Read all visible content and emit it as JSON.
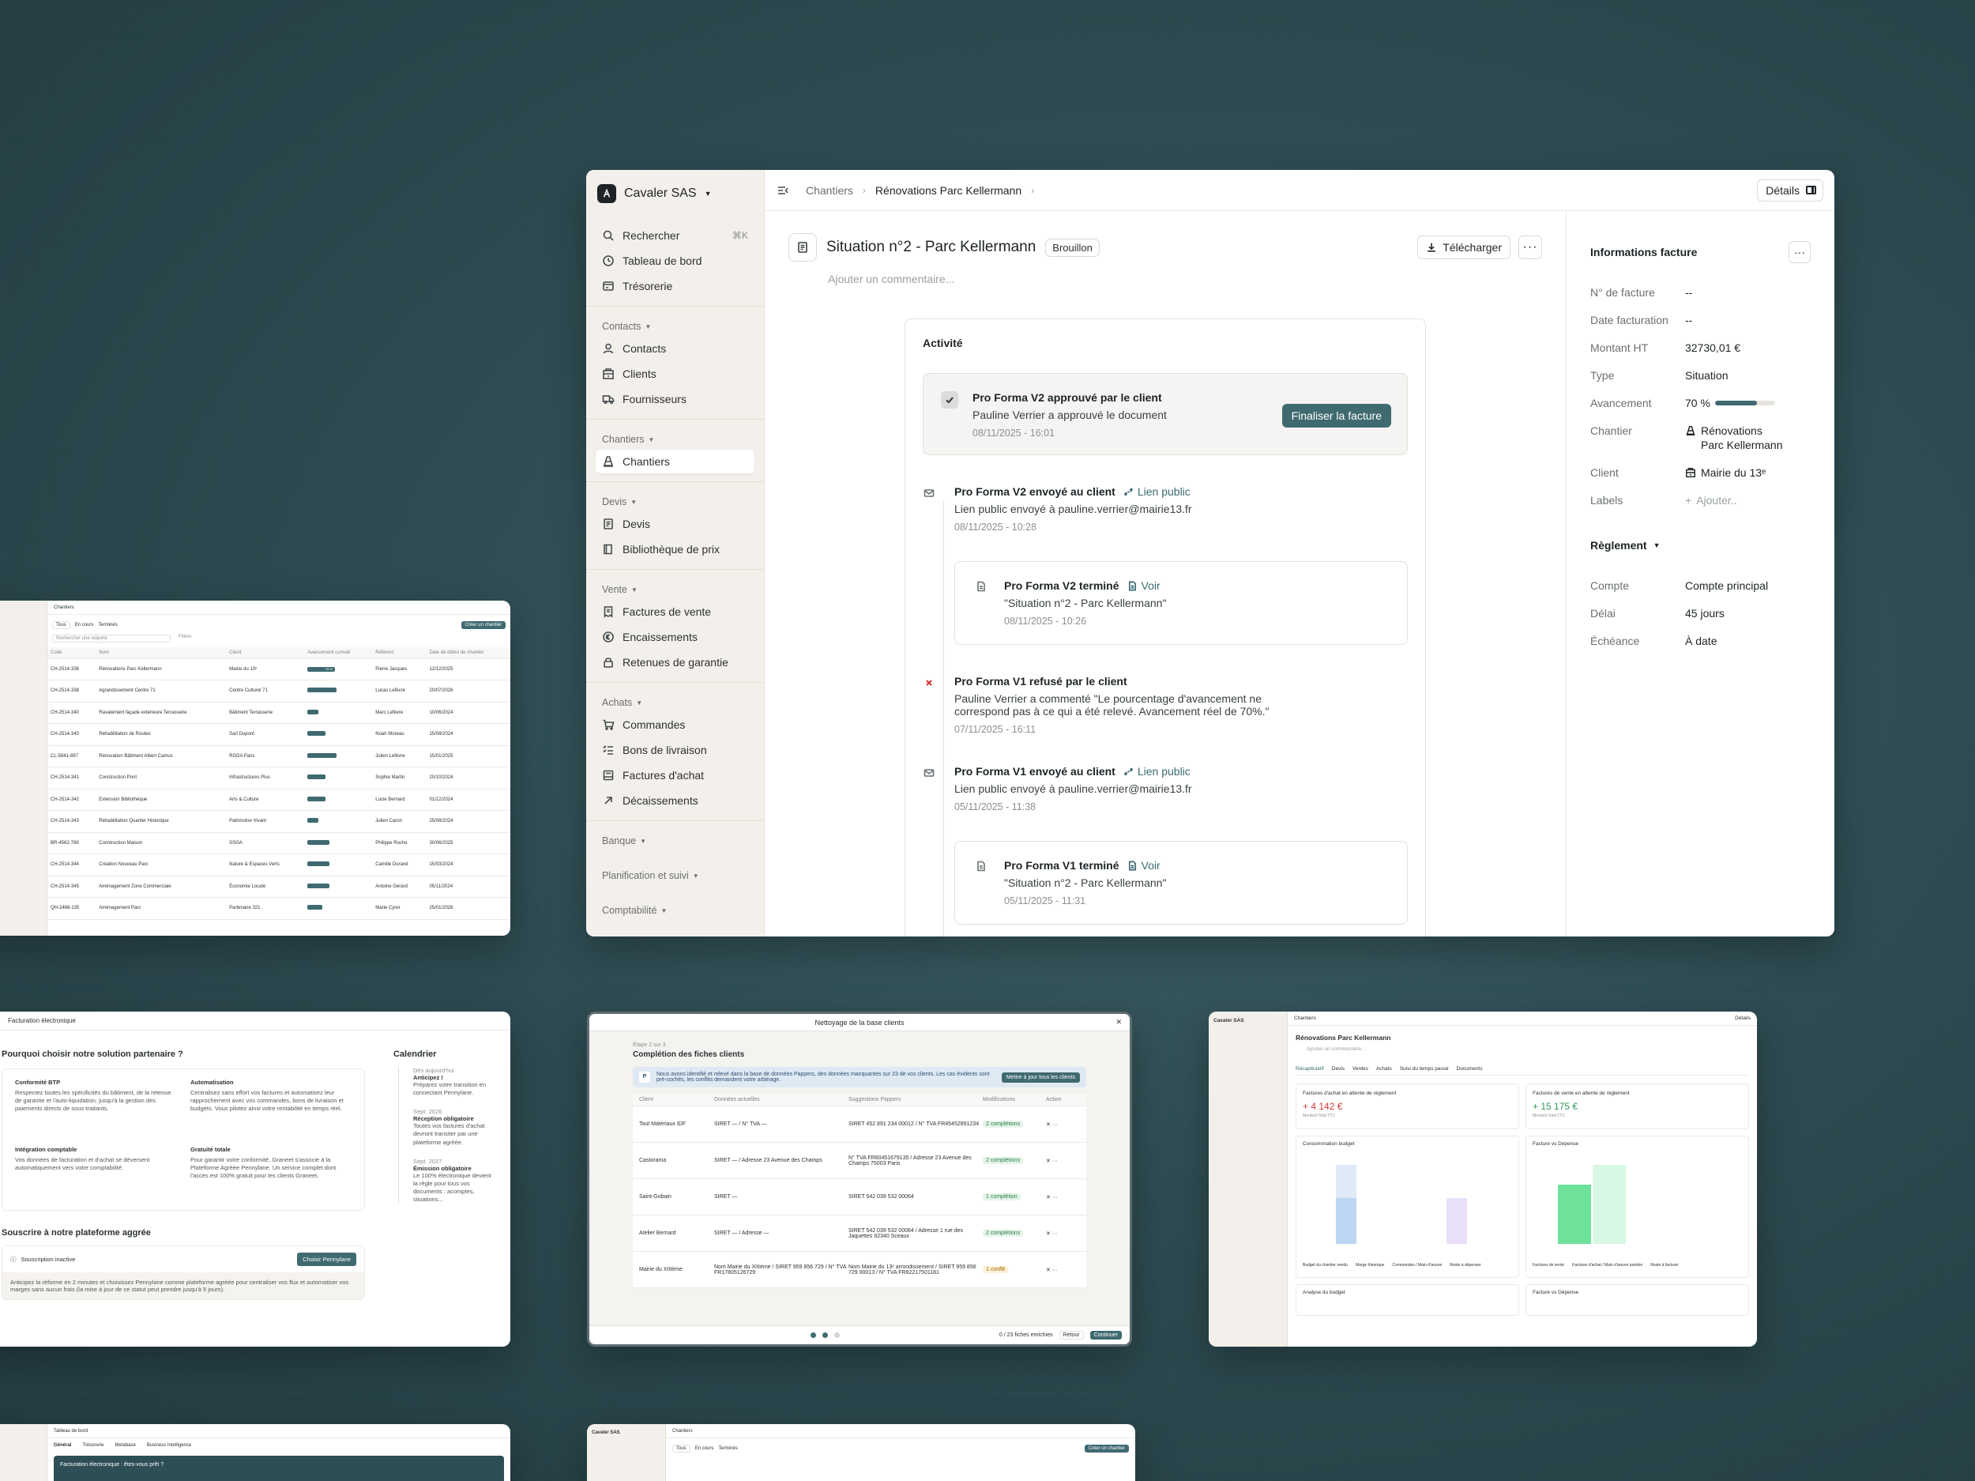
{
  "brand": {
    "name": "Cavaler SAS"
  },
  "sidebar": {
    "search": {
      "label": "Rechercher",
      "shortcut": "⌘K"
    },
    "top": [
      "Tableau de bord",
      "Trésorerie"
    ],
    "groups": [
      {
        "title": "Contacts",
        "items": [
          "Contacts",
          "Clients",
          "Fournisseurs"
        ]
      },
      {
        "title": "Chantiers",
        "items": [
          "Chantiers"
        ]
      },
      {
        "title": "Devis",
        "items": [
          "Devis",
          "Bibliothèque de prix"
        ]
      },
      {
        "title": "Vente",
        "items": [
          "Factures de vente",
          "Encaissements",
          "Retenues de garantie"
        ]
      },
      {
        "title": "Achats",
        "items": [
          "Commandes",
          "Bons de livraison",
          "Factures d'achat",
          "Décaissements"
        ]
      }
    ],
    "collapsed": [
      "Banque",
      "Planification et suivi",
      "Comptabilité"
    ]
  },
  "breadcrumb": {
    "parent": "Chantiers",
    "current": "Rénovations Parc Kellermann"
  },
  "details_button": "Détails",
  "page": {
    "title": "Situation n°2 - Parc Kellermann",
    "status": "Brouillon",
    "download": "Télécharger",
    "comment_placeholder": "Ajouter un commentaire..."
  },
  "activity": {
    "heading": "Activité",
    "approved": {
      "title": "Pro Forma V2 approuvé par le client",
      "subtitle": "Pauline Verrier a approuvé le document",
      "time": "08/11/2025 - 16:01",
      "action": "Finaliser la facture"
    },
    "events": [
      {
        "title": "Pro Forma V2 envoyé au client",
        "link": "Lien public",
        "subtitle": "Lien public envoyé à pauline.verrier@mairie13.fr",
        "time": "08/11/2025 - 10:28"
      },
      {
        "title": "Pro Forma V2 terminé",
        "link": "Voir",
        "subtitle": "\"Situation n°2 - Parc Kellermann\"",
        "time": "08/11/2025 - 10:26"
      },
      {
        "title": "Pro Forma V1 refusé par le client",
        "subtitle": "Pauline Verrier a commenté \"Le pourcentage d'avancement ne correspond pas à ce qui a été relevé. Avancement réel de 70%.\"",
        "time": "07/11/2025 - 16:11"
      },
      {
        "title": "Pro Forma V1 envoyé au client",
        "link": "Lien public",
        "subtitle": "Lien public envoyé à pauline.verrier@mairie13.fr",
        "time": "05/11/2025 - 11:38"
      },
      {
        "title": "Pro Forma V1 terminé",
        "link": "Voir",
        "subtitle": "\"Situation n°2 - Parc Kellermann\"",
        "time": "05/11/2025 - 11:31"
      }
    ]
  },
  "invoice_info": {
    "heading": "Informations facture",
    "rows": [
      {
        "k": "N° de facture",
        "v": "--"
      },
      {
        "k": "Date facturation",
        "v": "--"
      },
      {
        "k": "Montant HT",
        "v": "32730,01 €"
      },
      {
        "k": "Type",
        "v": "Situation"
      },
      {
        "k": "Avancement",
        "v": "70 %"
      },
      {
        "k": "Chantier",
        "v": "Rénovations Parc Kellermann"
      },
      {
        "k": "Client",
        "v": "Mairie du 13ᵉ"
      },
      {
        "k": "Labels",
        "v": "Ajouter.."
      }
    ],
    "progress": 0.7,
    "settlement_heading": "Règlement",
    "settlement": [
      {
        "k": "Compte",
        "v": "Compte principal"
      },
      {
        "k": "Délai",
        "v": "45 jours"
      },
      {
        "k": "Échéance",
        "v": "À date"
      }
    ]
  },
  "thumb_chantiers": {
    "title": "Chantiers",
    "tabs": [
      "Tous",
      "En cours",
      "Terminés"
    ],
    "create": "Créer un chantier",
    "search": "Rechercher une requete",
    "filters": "Filtres",
    "columns": [
      "Code",
      "Nom",
      "Client",
      "Avancement cumulé",
      "Référent",
      "Date de début de chantier"
    ],
    "rows": [
      [
        "CH-2514-336",
        "Rénovations Parc Kellermann",
        "Mairie du 13ᵉ",
        "76 %",
        "Pierre Jacques",
        "12/12/2025"
      ],
      [
        "CH-2514-338",
        "Agrandissement Centre 71",
        "Centre Culturel 71",
        "",
        "Lucas Lefèvre",
        "20/07/2026"
      ],
      [
        "CH-2514-340",
        "Ravalement façade extérieure Terrasserie",
        "Bâtiment Terrasserie",
        "",
        "Marc Lefèvre",
        "10/06/2024"
      ],
      [
        "CH-2514-340",
        "Réhabilitation de Routes",
        "Sarl Dupont",
        "",
        "Noah Moreau",
        "15/08/2024"
      ],
      [
        "CL-5841-887",
        "Rénovation Bâtiment Albert Camus",
        "RGDA Paris",
        "",
        "Julien Lefèvre",
        "15/01/2025"
      ],
      [
        "CH-2514-341",
        "Construction Pont",
        "Infrastructures Plus",
        "",
        "Sophie Martin",
        "20/10/2024"
      ],
      [
        "CH-2514-342",
        "Extension Bibliothèque",
        "Arts & Culture",
        "",
        "Lucie Bernard",
        "01/12/2024"
      ],
      [
        "CH-2514-343",
        "Réhabilitation Quartier Historique",
        "Patrimoine Vivant",
        "",
        "Julien Caron",
        "25/08/2024"
      ],
      [
        "BR-4562-789",
        "Construction Maison",
        "SSGA",
        "",
        "Philippe Roche",
        "30/06/2025"
      ],
      [
        "CH-2514-344",
        "Création Nouveau Parc",
        "Nature & Espaces Verts",
        "",
        "Camille Durand",
        "15/03/2024"
      ],
      [
        "CH-2514-345",
        "Aménagement Zone Commerciale",
        "Économie Locale",
        "",
        "Antoine Gérard",
        "05/11/2024"
      ],
      [
        "QH-2468-135",
        "Aménagement Parc",
        "Partenaire 321",
        "",
        "Marie Cyrer",
        "25/01/2026"
      ]
    ],
    "progress": [
      0.76,
      0.8,
      0.3,
      0.5,
      0.8,
      0.5,
      0.5,
      0.3,
      0.6,
      0.6,
      0.6,
      0.4
    ]
  },
  "thumb_einvoice": {
    "title": "Facturation électronique",
    "heading": "Pourquoi choisir notre solution partenaire ?",
    "features": [
      {
        "t": "Conformité BTP",
        "d": "Respectez toutes les spécificités du bâtiment, de la retenue de garantie et l'auto-liquidation, jusqu'à la gestion des paiements directs de sous-traitants."
      },
      {
        "t": "Automatisation",
        "d": "Centralisez sans effort vos factures et automatisez leur rapprochement avec vos commandes, bons de livraison et budgets. Vous pilotez ainsi votre rentabilité en temps réel."
      },
      {
        "t": "Intégration comptable",
        "d": "Vos données de facturation et d'achat se déversent automatiquement vers votre comptabilité."
      },
      {
        "t": "Gratuité totale",
        "d": "Pour garantir votre conformité, Graneet s'associe à la Plateforme Agréée Pennylane. Un service complet dont l'accès est 100% gratuit pour les clients Graneet."
      }
    ],
    "subscribe_heading": "Souscrire à notre plateforme aggrée",
    "status": "Souscription inactive",
    "choose": "Choisir Pennylane",
    "note": "Anticipez la réforme en 2 minutes et choisissez Pennylane comme plateforme agréée pour centraliser vos flux et automatiser vos marges sans aucun frais (la mise à jour de ce statut peut prendre jusqu'à 5 jours).",
    "calendar": "Calendrier",
    "steps": [
      {
        "d": "Dès aujourd'hui",
        "t": "Anticipez !",
        "x": "Préparez votre transition en connectant Pennylane."
      },
      {
        "d": "Sept. 2026",
        "t": "Réception obligatoire",
        "x": "Toutes vos factures d'achat devront transiter par une plateforme agréée."
      },
      {
        "d": "Sept. 2027",
        "t": "Émission obligatoire",
        "x": "Le 100% électronique devient la règle pour tous vos documents : acomptes, situations..."
      }
    ]
  },
  "thumb_cleanup": {
    "title": "Nettoyage de la base clients",
    "step": "Étape 2 sur 3",
    "heading": "Complétion des fiches clients",
    "banner": "Nous avons identifié et relevé dans la base de données Pappers, des données manquantes sur 23 de vos clients. Les cas évidents sont pré-cochés, les conflits demandent votre arbitrage.",
    "banner_btn": "Mettre à jour tous les clients",
    "columns": [
      "Client",
      "Données actuelles",
      "Suggestions Pappers",
      "Modifications",
      "Action"
    ],
    "rows": [
      {
        "c": "Tout Matériaux IDF",
        "a": "SIRET —  /  N° TVA —",
        "s": "SIRET 452 891 234 00012  /  N° TVA FR45452891234",
        "m": "2 complétions"
      },
      {
        "c": "Castorama",
        "a": "SIRET —  /  Adresse 23 Avenue des Champs",
        "s": "N° TVA FR60451679135  /  Adresse 23 Avenue des Champs 75003 Paris",
        "m": "2 complétions"
      },
      {
        "c": "Saint-Gobain",
        "a": "SIRET —",
        "s": "SIRET 542 039 532 00064",
        "m": "1 complétion"
      },
      {
        "c": "Atelier Bernard",
        "a": "SIRET —  /  Adresse —",
        "s": "SIRET 542 039 532 00064  /  Adresse 1 rue des Jaquettes 92340 Sceaux",
        "m": "2 complétions"
      },
      {
        "c": "Mairie du XIIIème",
        "a": "Nom Mairie du XIIIème  /  SIRET 959 856 729  /  N° TVA FR17805126729",
        "s": "Nom Mairie du 13ᵉ arrondissement  /  SIRET 959 856 729 00013  /  N° TVA FR82217501181",
        "m": "1 conflit"
      }
    ],
    "footer_count": "0 / 23 fiches enrichies",
    "back": "Retour",
    "next": "Continuer"
  },
  "thumb_dashboard": {
    "title": "Rénovations Parc Kellermann",
    "comment": "Ajouter un commentaire...",
    "tabs": [
      "Récapitulatif",
      "Devis",
      "Ventes",
      "Achats",
      "Suivi du temps passé",
      "Documents"
    ],
    "cards": [
      {
        "t": "Factures d'achat en attente de règlement",
        "v": "+ 4 142 €",
        "s": "Montant Total TTC"
      },
      {
        "t": "Factures de vente en attente de règlement",
        "v": "+ 15 175 €",
        "s": "Montant Total TTC"
      }
    ],
    "chart1": {
      "t": "Consommation budget",
      "legend": [
        "Budget du chantier vendu",
        "Marge théorique",
        "Commandes / Main d'œuvre",
        "Reste à dépenser"
      ]
    },
    "chart2": {
      "t": "Facture vs Dépense",
      "legend": [
        "Factures de vente",
        "Factures d'achat / Main d'œuvre pointée",
        "Reste à facturer"
      ]
    },
    "below": [
      "Analyse du budget",
      "Facture vs Dépense"
    ]
  },
  "thumb_bottom_left": {
    "title": "Tableau de bord",
    "tabs": [
      "Général",
      "Trésorerie",
      "Metabase",
      "Business Intelligence"
    ],
    "banner": "Facturation électronique : êtes-vous prêt ?"
  },
  "thumb_bottom_mid": {
    "title": "Chantiers",
    "tabs": [
      "Tous",
      "En cours",
      "Terminés"
    ],
    "create": "Créer un chantier"
  }
}
